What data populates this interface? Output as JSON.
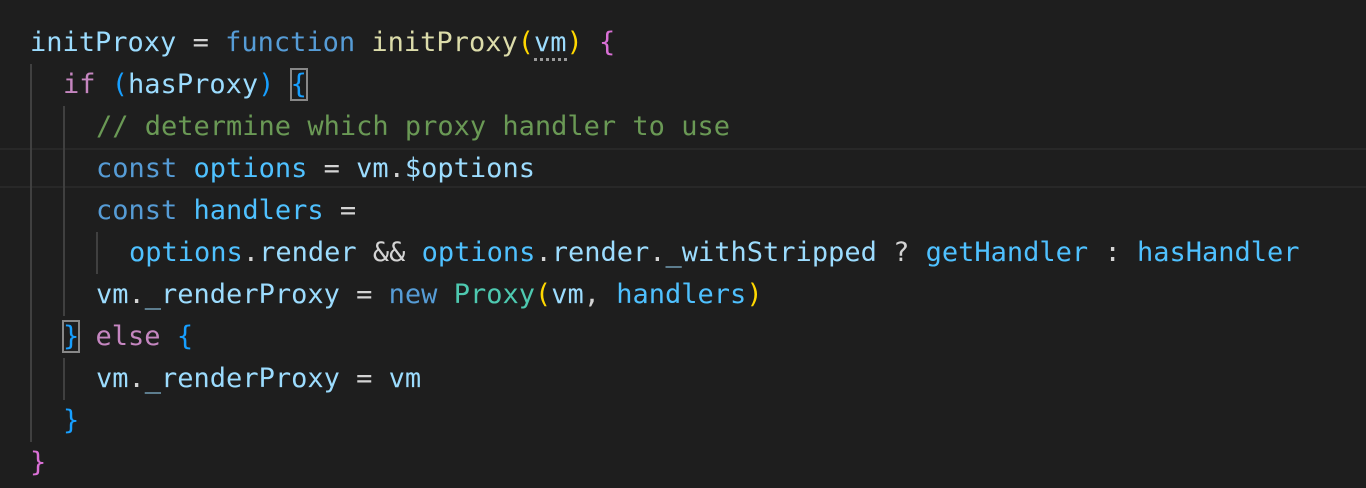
{
  "colors": {
    "background": "#1e1e1e",
    "variable": "#9cdcfe",
    "function_name": "#dcdcaa",
    "storage_keyword": "#569cd6",
    "control_keyword": "#c586c0",
    "comment": "#6a9955",
    "class_name": "#4ec9b0",
    "operator": "#d4d4d4",
    "constant": "#4fc1ff",
    "bracket_level1": "#ffd700",
    "bracket_level2": "#da70d6",
    "bracket_level3": "#179fff"
  },
  "editor": {
    "language": "javascript",
    "lines": [
      {
        "indent": 0,
        "tokens": [
          {
            "text": "initProxy",
            "kind": "variable"
          },
          {
            "text": " = ",
            "kind": "operator"
          },
          {
            "text": "function",
            "kind": "storage_keyword"
          },
          {
            "text": " ",
            "kind": "operator"
          },
          {
            "text": "initProxy",
            "kind": "function_name"
          },
          {
            "text": "(",
            "kind": "bracket_level1"
          },
          {
            "text": "vm",
            "kind": "variable",
            "marker": "unused-hint"
          },
          {
            "text": ")",
            "kind": "bracket_level1"
          },
          {
            "text": " ",
            "kind": "operator"
          },
          {
            "text": "{",
            "kind": "bracket_level2"
          }
        ]
      },
      {
        "indent": 1,
        "tokens": [
          {
            "text": "if",
            "kind": "control_keyword"
          },
          {
            "text": " ",
            "kind": "operator"
          },
          {
            "text": "(",
            "kind": "bracket_level3"
          },
          {
            "text": "hasProxy",
            "kind": "variable"
          },
          {
            "text": ")",
            "kind": "bracket_level3"
          },
          {
            "text": " ",
            "kind": "operator"
          },
          {
            "text": "{",
            "kind": "bracket_level3",
            "marker": "bracket-match"
          }
        ]
      },
      {
        "indent": 2,
        "tokens": [
          {
            "text": "// determine which proxy handler to use",
            "kind": "comment"
          }
        ]
      },
      {
        "indent": 2,
        "tokens": [
          {
            "text": "const",
            "kind": "storage_keyword"
          },
          {
            "text": " ",
            "kind": "operator"
          },
          {
            "text": "options",
            "kind": "constant"
          },
          {
            "text": " = ",
            "kind": "operator"
          },
          {
            "text": "vm",
            "kind": "variable"
          },
          {
            "text": ".",
            "kind": "operator"
          },
          {
            "text": "$options",
            "kind": "variable"
          }
        ]
      },
      {
        "indent": 2,
        "tokens": [
          {
            "text": "const",
            "kind": "storage_keyword"
          },
          {
            "text": " ",
            "kind": "operator"
          },
          {
            "text": "handlers",
            "kind": "constant"
          },
          {
            "text": " =",
            "kind": "operator"
          }
        ]
      },
      {
        "indent": 3,
        "tokens": [
          {
            "text": "options",
            "kind": "constant"
          },
          {
            "text": ".",
            "kind": "operator"
          },
          {
            "text": "render",
            "kind": "variable"
          },
          {
            "text": " && ",
            "kind": "operator"
          },
          {
            "text": "options",
            "kind": "constant"
          },
          {
            "text": ".",
            "kind": "operator"
          },
          {
            "text": "render",
            "kind": "variable"
          },
          {
            "text": ".",
            "kind": "operator"
          },
          {
            "text": "_withStripped",
            "kind": "variable"
          },
          {
            "text": " ? ",
            "kind": "operator"
          },
          {
            "text": "getHandler",
            "kind": "constant"
          },
          {
            "text": " : ",
            "kind": "operator"
          },
          {
            "text": "hasHandler",
            "kind": "constant"
          }
        ]
      },
      {
        "indent": 2,
        "tokens": [
          {
            "text": "vm",
            "kind": "variable"
          },
          {
            "text": ".",
            "kind": "operator"
          },
          {
            "text": "_renderProxy",
            "kind": "variable"
          },
          {
            "text": " = ",
            "kind": "operator"
          },
          {
            "text": "new",
            "kind": "storage_keyword"
          },
          {
            "text": " ",
            "kind": "operator"
          },
          {
            "text": "Proxy",
            "kind": "class_name"
          },
          {
            "text": "(",
            "kind": "bracket_level1"
          },
          {
            "text": "vm",
            "kind": "variable"
          },
          {
            "text": ", ",
            "kind": "operator"
          },
          {
            "text": "handlers",
            "kind": "constant"
          },
          {
            "text": ")",
            "kind": "bracket_level1"
          }
        ]
      },
      {
        "indent": 1,
        "tokens": [
          {
            "text": "}",
            "kind": "bracket_level3",
            "marker": "bracket-match"
          },
          {
            "text": " ",
            "kind": "operator"
          },
          {
            "text": "else",
            "kind": "control_keyword"
          },
          {
            "text": " ",
            "kind": "operator"
          },
          {
            "text": "{",
            "kind": "bracket_level3"
          }
        ]
      },
      {
        "indent": 2,
        "tokens": [
          {
            "text": "vm",
            "kind": "variable"
          },
          {
            "text": ".",
            "kind": "operator"
          },
          {
            "text": "_renderProxy",
            "kind": "variable"
          },
          {
            "text": " = ",
            "kind": "operator"
          },
          {
            "text": "vm",
            "kind": "variable"
          }
        ]
      },
      {
        "indent": 1,
        "tokens": [
          {
            "text": "}",
            "kind": "bracket_level3"
          }
        ]
      },
      {
        "indent": 0,
        "tokens": [
          {
            "text": "}",
            "kind": "bracket_level2"
          }
        ]
      }
    ]
  }
}
